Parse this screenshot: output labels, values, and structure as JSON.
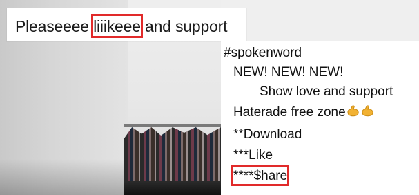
{
  "caption": {
    "before": "Pleaseeee ",
    "highlight": "liiikeee",
    "after": " and support"
  },
  "post": {
    "hashtag": "#spokenword",
    "line1": "NEW!  NEW! NEW!",
    "line2": "Show love and support",
    "line3": "Haterade free zone",
    "line3_emojis": [
      "flexed-biceps",
      "flexed-biceps"
    ],
    "line4": "**Download",
    "line5": "***Like",
    "line6": "****$hare"
  },
  "colors": {
    "highlight_border": "#e12a2a",
    "hashtag": "#2c4a8a",
    "emoji": "#f2b233"
  }
}
